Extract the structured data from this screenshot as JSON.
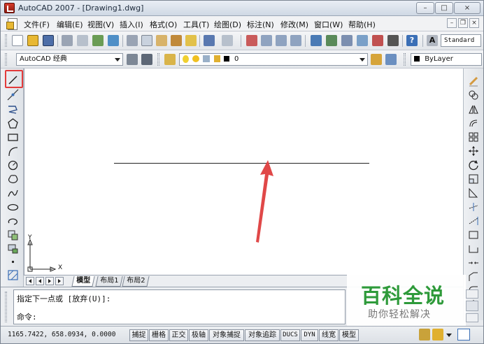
{
  "window": {
    "title": "AutoCAD 2007 - [Drawing1.dwg]",
    "controls": {
      "minimize": "–",
      "maximize": "□",
      "close": "×"
    }
  },
  "menubar": {
    "items": [
      "文件(F)",
      "编辑(E)",
      "视图(V)",
      "插入(I)",
      "格式(O)",
      "工具(T)",
      "绘图(D)",
      "标注(N)",
      "修改(M)",
      "窗口(W)",
      "帮助(H)"
    ],
    "doc_controls": {
      "minimize": "–",
      "restore": "❐",
      "close": "×"
    }
  },
  "toolbar_standard": {
    "text_style": "Standard",
    "icons": [
      "new-icon",
      "open-icon",
      "save-icon",
      "plot-icon",
      "plot-preview-icon",
      "publish-icon",
      "3d-publish-icon",
      "cut-icon",
      "copy-icon",
      "paste-icon",
      "match-properties-icon",
      "block-editor-icon",
      "undo-icon",
      "redo-icon",
      "pan-icon",
      "zoom-realtime-icon",
      "zoom-window-icon",
      "zoom-previous-icon",
      "properties-icon",
      "design-center-icon",
      "tool-palettes-icon",
      "sheet-set-icon",
      "markup-icon",
      "calculator-icon",
      "help-icon",
      "text-style-icon"
    ]
  },
  "toolbar_workspace": {
    "workspace": "AutoCAD 经典",
    "layer": "0",
    "color": "ByLayer"
  },
  "draw_toolbar": {
    "icons": [
      "line-icon",
      "construction-line-icon",
      "polyline-icon",
      "polygon-icon",
      "rectangle-icon",
      "arc-icon",
      "circle-icon",
      "revision-cloud-icon",
      "spline-icon",
      "ellipse-icon",
      "ellipse-arc-icon",
      "insert-block-icon",
      "make-block-icon",
      "point-icon",
      "hatch-icon"
    ],
    "highlighted": "line-icon"
  },
  "modify_toolbar": {
    "icons": [
      "erase-icon",
      "copy-object-icon",
      "mirror-icon",
      "offset-icon",
      "array-icon",
      "move-icon",
      "rotate-icon",
      "scale-icon",
      "stretch-icon",
      "trim-icon",
      "extend-icon",
      "break-at-point-icon",
      "break-icon",
      "join-icon",
      "chamfer-icon",
      "fillet-icon",
      "explode-icon"
    ]
  },
  "ucs": {
    "x_label": "X",
    "y_label": "Y"
  },
  "layout_tabs": [
    "模型",
    "布局1",
    "布局2"
  ],
  "command_window": {
    "line1": "指定下一点或 [放弃(U)]:",
    "line2": "命令:"
  },
  "statusbar": {
    "coordinates": "1165.7422, 658.0934, 0.0000",
    "buttons": [
      "捕捉",
      "栅格",
      "正交",
      "极轴",
      "对象捕捉",
      "对象追踪",
      "DUCS",
      "DYN",
      "线宽",
      "模型"
    ]
  },
  "watermark": {
    "title": "百科全说",
    "subtitle": "助你轻松解决"
  },
  "colors": {
    "highlight": "#e23b3b",
    "arrow": "#e04848",
    "watermark_green": "#2e9a3a"
  }
}
